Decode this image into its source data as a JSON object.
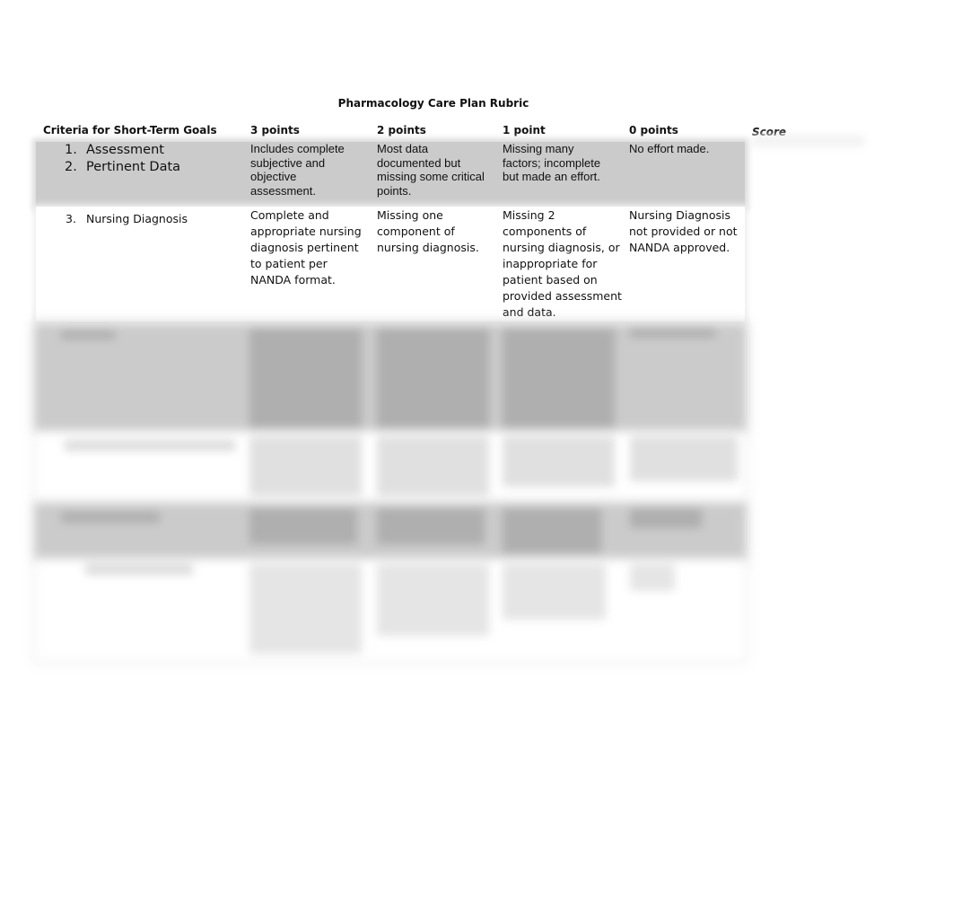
{
  "document": {
    "title": "Pharmacology Care Plan Rubric",
    "headers": {
      "criteria": "Criteria for Short-Term Goals",
      "col3": "3 points",
      "col2": "2 points",
      "col1": "1 point",
      "col0": "0 points",
      "score": "Score"
    },
    "rows": [
      {
        "criteria": [
          {
            "num": "1.",
            "label": "Assessment"
          },
          {
            "num": "2.",
            "label": "Pertinent Data"
          }
        ],
        "pts3": "Includes complete subjective and objective assessment.",
        "pts2": "Most data documented but missing some critical points.",
        "pts1": "Missing many factors; incomplete but made an effort.",
        "pts0": "No effort made."
      },
      {
        "criteria": [
          {
            "num": "3.",
            "label": "Nursing Diagnosis"
          }
        ],
        "pts3": "Complete and appropriate nursing diagnosis pertinent to patient per NANDA format.",
        "pts2": "Missing one component of nursing diagnosis.",
        "pts1": "Missing 2 components of nursing diagnosis, or inappropriate for patient based on provided assessment and data.",
        "pts0": "Nursing Diagnosis not provided or not NANDA approved."
      }
    ],
    "obscured_rows_count": 4
  }
}
